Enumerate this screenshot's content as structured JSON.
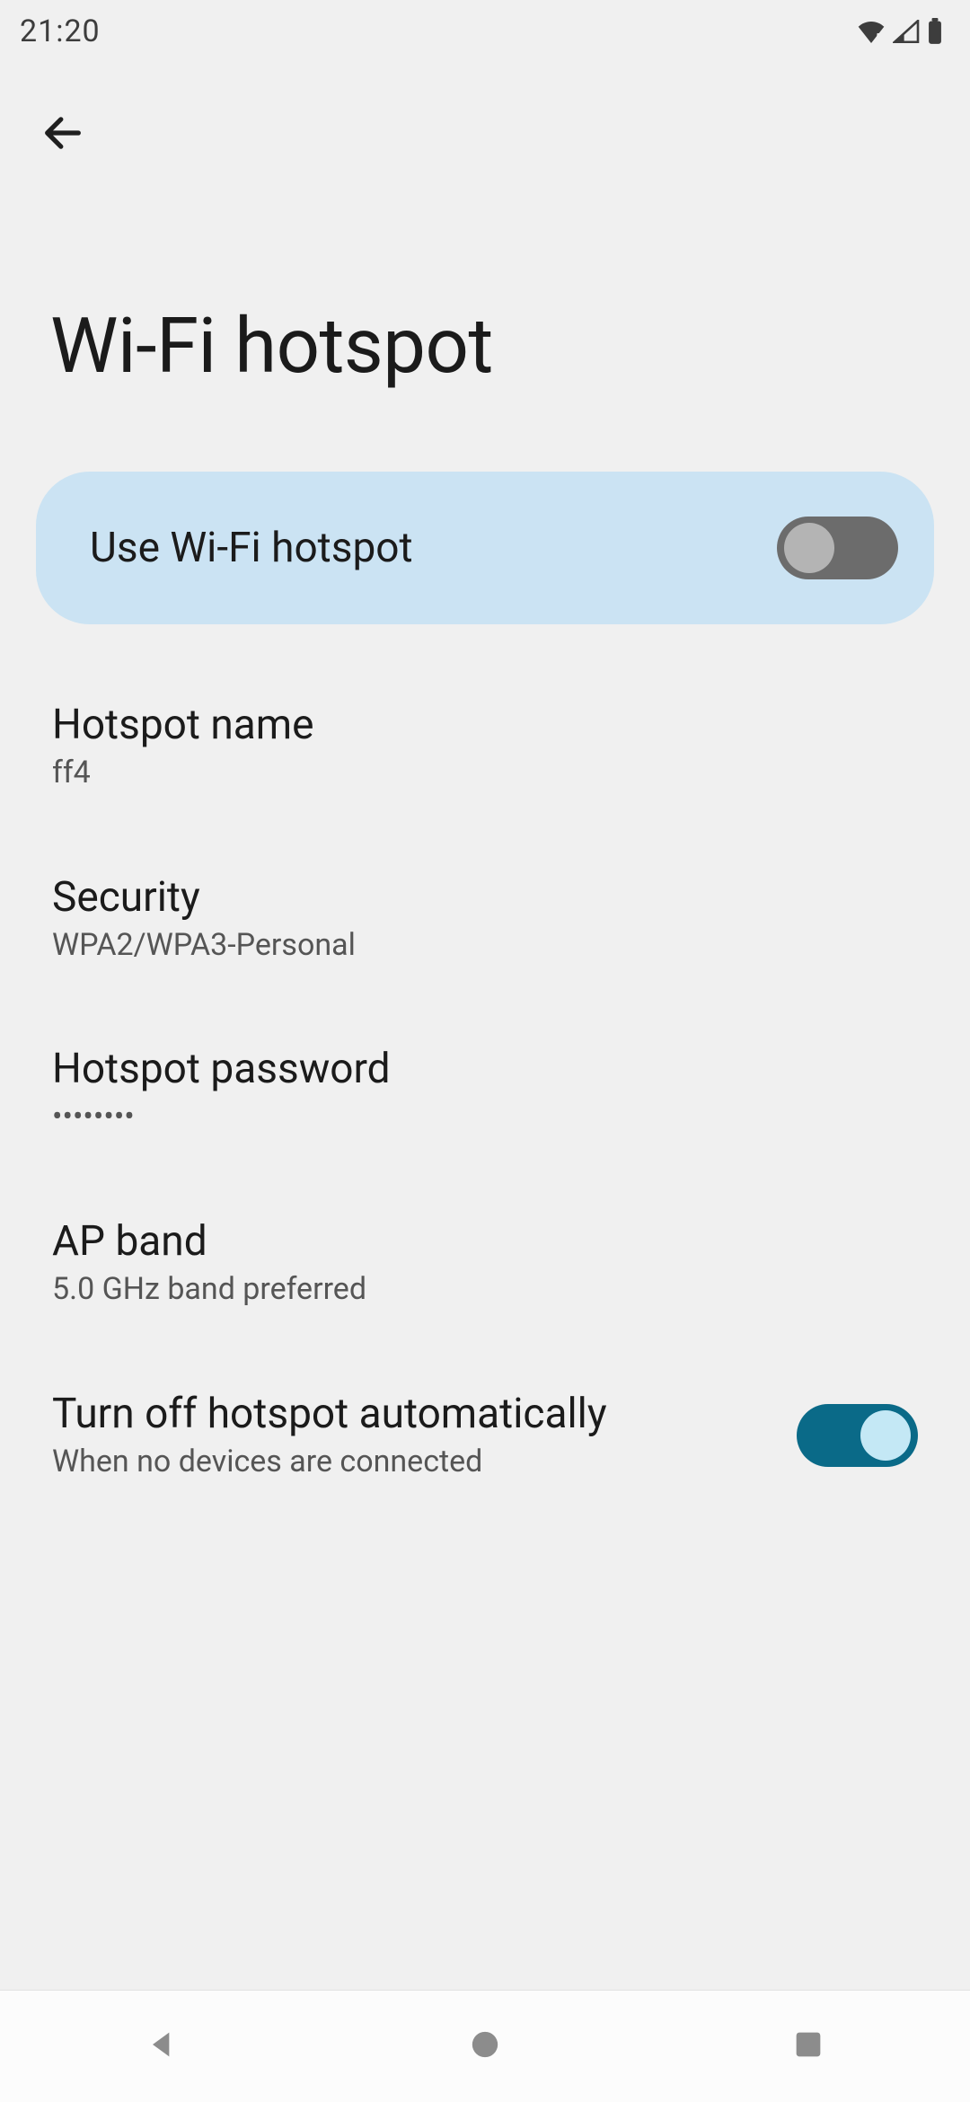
{
  "status": {
    "time": "21:20"
  },
  "page": {
    "title": "Wi-Fi hotspot"
  },
  "master": {
    "label": "Use Wi-Fi hotspot",
    "enabled": false
  },
  "settings": {
    "hotspotName": {
      "title": "Hotspot name",
      "value": "ff4"
    },
    "security": {
      "title": "Security",
      "value": "WPA2/WPA3-Personal"
    },
    "password": {
      "title": "Hotspot password",
      "value": "••••••••"
    },
    "apBand": {
      "title": "AP band",
      "value": "5.0 GHz band preferred"
    },
    "autoOff": {
      "title": "Turn off hotspot automatically",
      "subtitle": "When no devices are connected",
      "enabled": true
    }
  }
}
